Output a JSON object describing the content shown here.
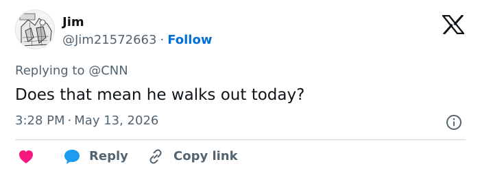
{
  "author": {
    "name": "Jim",
    "handle": "@Jim21572663",
    "separator": "·",
    "follow_label": "Follow"
  },
  "reply_context": {
    "prefix": "Replying to",
    "mention": "@CNN"
  },
  "tweet": {
    "text": "Does that mean he walks out today?",
    "time": "3:28 PM",
    "separator": "·",
    "date": "May 13, 2026"
  },
  "actions": {
    "reply_label": "Reply",
    "copy_link_label": "Copy link"
  },
  "icons": {
    "like": "heart-icon",
    "reply": "speech-bubble-icon",
    "copy": "link-icon",
    "info": "info-icon",
    "brand": "x-logo-icon"
  },
  "colors": {
    "like": "#f91880",
    "reply": "#1d9bf0",
    "link": "#006fd6",
    "secondary_text": "#536471",
    "primary_text": "#0f1419",
    "divider": "#cfd9de"
  }
}
